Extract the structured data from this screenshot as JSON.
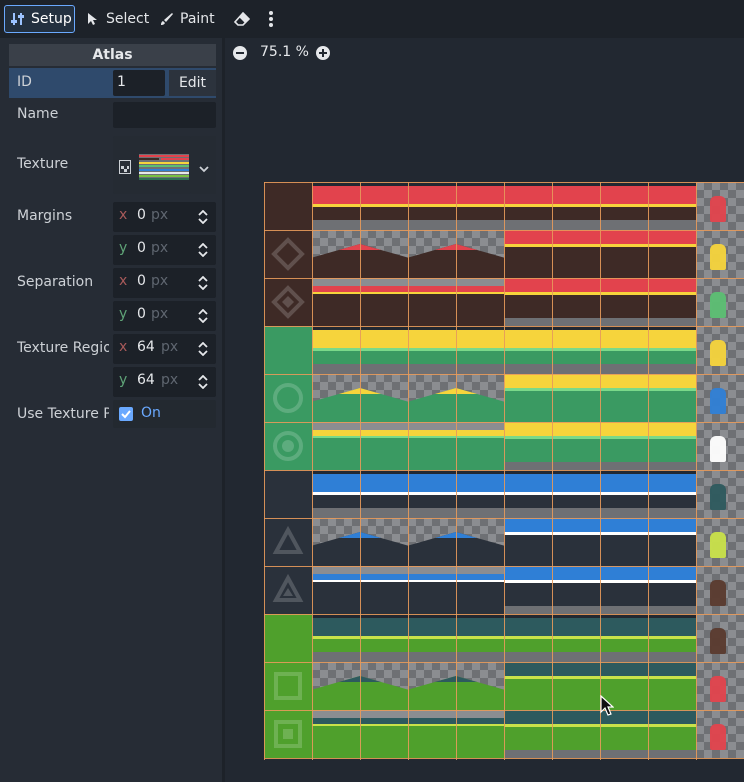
{
  "toolbar": {
    "setup_label": "Setup",
    "select_label": "Select",
    "paint_label": "Paint"
  },
  "sidebar": {
    "title": "Atlas",
    "id": {
      "label": "ID",
      "value": "1",
      "edit_label": "Edit"
    },
    "name": {
      "label": "Name",
      "value": ""
    },
    "texture": {
      "label": "Texture"
    },
    "margins": {
      "label": "Margins",
      "x_axis": "x",
      "x_value": "0",
      "y_axis": "y",
      "y_value": "0",
      "unit": "px"
    },
    "separation": {
      "label": "Separation",
      "x_axis": "x",
      "x_value": "0",
      "y_axis": "y",
      "y_value": "0",
      "unit": "px"
    },
    "texture_region": {
      "label": "Texture Regio",
      "x_axis": "x",
      "x_value": "64",
      "y_axis": "y",
      "y_value": "64",
      "unit": "px"
    },
    "use_texture_padding": {
      "label": "Use Texture P",
      "checked": true,
      "value_label": "On"
    }
  },
  "viewport": {
    "zoom_text": "75.1 %"
  },
  "colors": {
    "accent": "#6aa9ff",
    "grid": "#e79a5b",
    "red_top": "#e2434d",
    "yellow_top": "#f6d43c",
    "green_top": "#5cbf73",
    "blue_top": "#2f7fd6",
    "lime_top": "#7ac143",
    "dark_brown": "#3e2a26",
    "dark_green": "#3a9a62",
    "dark_slate": "#2a313b",
    "lime_dark": "#4fa02c"
  }
}
